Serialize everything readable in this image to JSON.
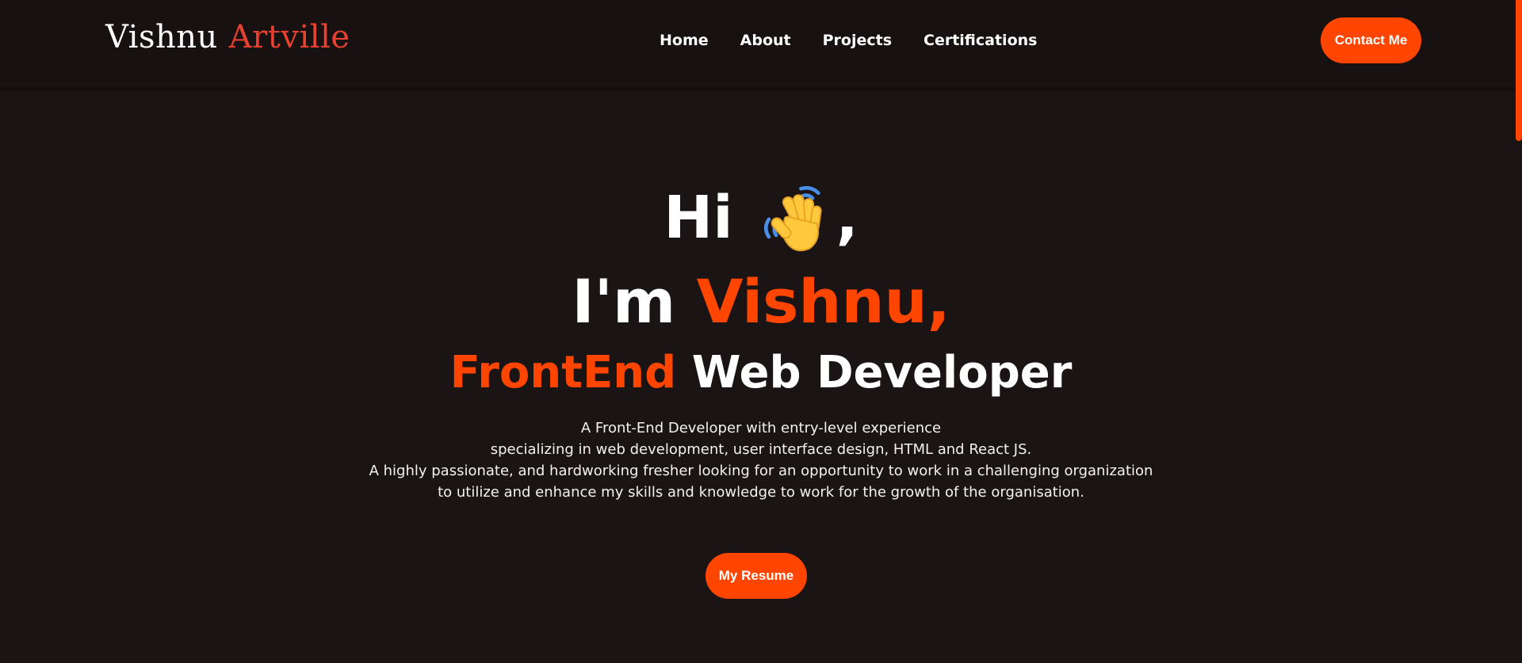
{
  "header": {
    "logo_first": "Vishnu",
    "logo_second": "Artville",
    "nav": [
      {
        "label": "Home"
      },
      {
        "label": "About"
      },
      {
        "label": "Projects"
      },
      {
        "label": "Certifications"
      }
    ],
    "contact_label": "Contact Me"
  },
  "hero": {
    "greeting": "Hi",
    "greeting_comma": ",",
    "wave_icon": "waving-hand-icon",
    "intro_prefix": "I'm",
    "name": "Vishnu,",
    "role_accent": "FrontEnd",
    "role_rest": "Web Developer",
    "description": [
      "A Front-End Developer with entry-level experience",
      "specializing in web development, user interface design, HTML and React JS.",
      "A highly passionate, and hardworking fresher looking for an opportunity to work in a challenging organization",
      "to utilize and enhance my skills and knowledge to work for the growth of the organisation."
    ],
    "resume_label": "My Resume"
  },
  "colors": {
    "background": "#1b1414",
    "header_background": "#181111",
    "accent": "#ff4500",
    "logo_accent": "#e8412f",
    "text": "#ffffff"
  }
}
